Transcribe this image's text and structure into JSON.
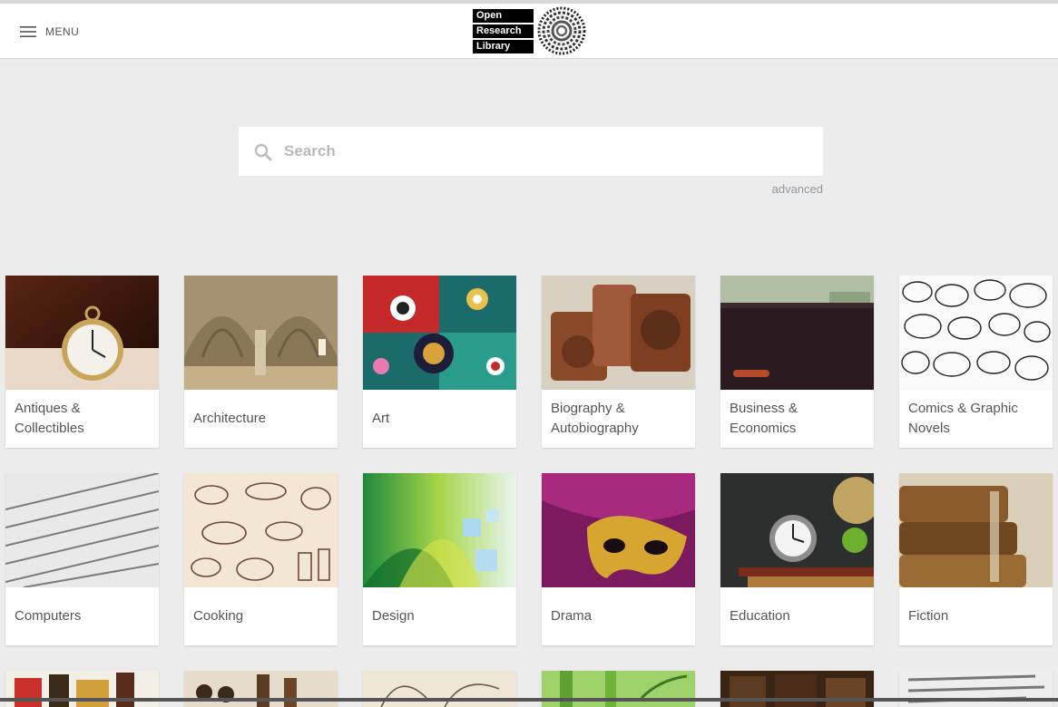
{
  "header": {
    "menu_label": "MENU",
    "logo_words": [
      "Open",
      "Research",
      "Library"
    ]
  },
  "search": {
    "placeholder": "Search",
    "advanced_label": "advanced"
  },
  "categories": [
    {
      "label": "Antiques & Collectibles",
      "icon": "pocket-watch-photo"
    },
    {
      "label": "Architecture",
      "icon": "vaulted-hall-photo"
    },
    {
      "label": "Art",
      "icon": "colorful-swirls-art"
    },
    {
      "label": "Biography & Autobiography",
      "icon": "wood-type-letters-photo"
    },
    {
      "label": "Business & Economics",
      "icon": "wallet-and-money-photo"
    },
    {
      "label": "Comics & Graphic Novels",
      "icon": "speech-bubbles-drawing"
    },
    {
      "label": "Computers",
      "icon": "html-code-photo"
    },
    {
      "label": "Cooking",
      "icon": "kitchen-sketch-pattern"
    },
    {
      "label": "Design",
      "icon": "green-waves-graphic"
    },
    {
      "label": "Drama",
      "icon": "golden-mask-photo"
    },
    {
      "label": "Education",
      "icon": "alarm-clock-books-photo"
    },
    {
      "label": "Fiction",
      "icon": "old-books-photo"
    }
  ],
  "row3_icons": [
    "word-cloud-photo",
    "chess-pieces-photo",
    "botanical-sketch",
    "bamboo-photo",
    "old-book-spines-photo",
    "newspaper-text-photo"
  ]
}
